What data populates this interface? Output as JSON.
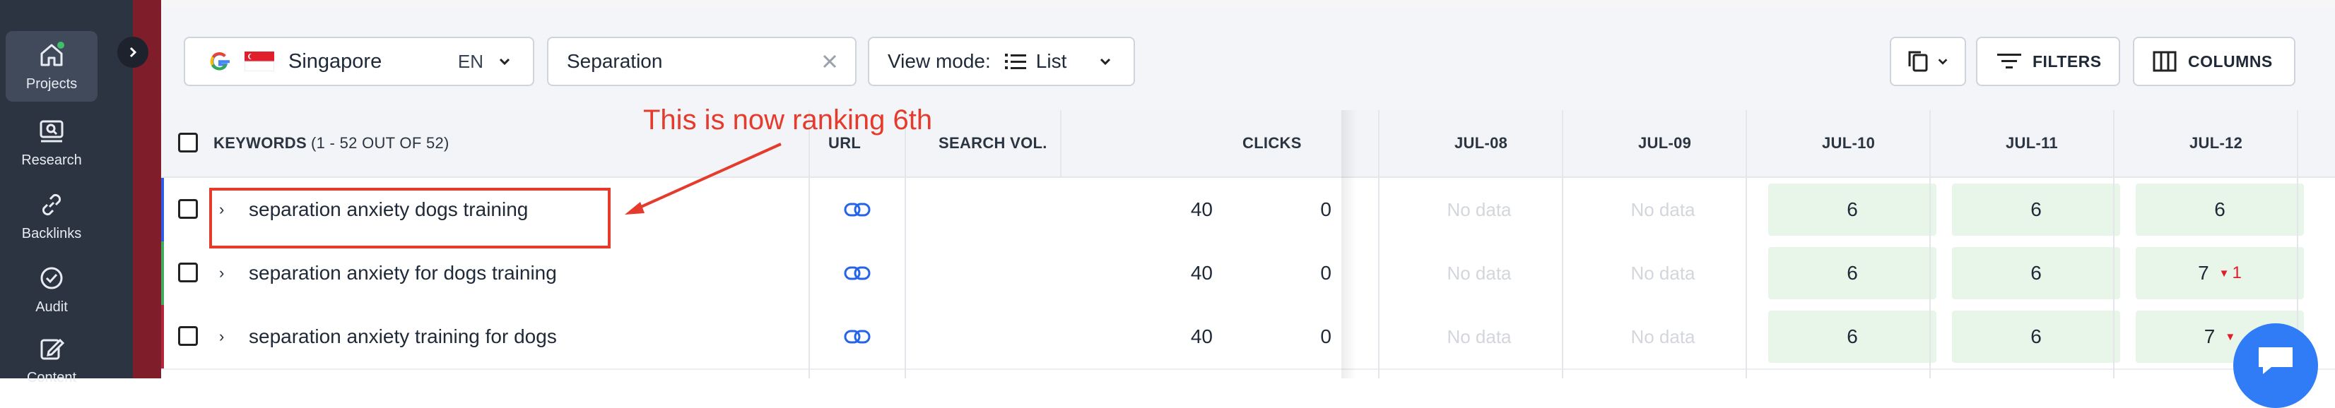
{
  "sidebar": {
    "items": [
      {
        "label": "Projects",
        "icon": "home-icon",
        "active": true
      },
      {
        "label": "Research",
        "icon": "research-icon"
      },
      {
        "label": "Backlinks",
        "icon": "link-icon"
      },
      {
        "label": "Audit",
        "icon": "check-circle-icon"
      },
      {
        "label": "Content",
        "icon": "edit-icon"
      }
    ]
  },
  "toolbar": {
    "location": "Singapore",
    "language": "EN",
    "search_value": "Separation",
    "view_mode_label": "View mode:",
    "view_mode_value": "List",
    "filters_label": "FILTERS",
    "columns_label": "COLUMNS"
  },
  "table": {
    "headers": {
      "keywords": "KEYWORDS",
      "keywords_count": "(1 - 52 OUT OF 52)",
      "url": "URL",
      "search_vol": "SEARCH VOL.",
      "clicks": "CLICKS"
    },
    "date_headers": [
      "JUL-08",
      "JUL-09",
      "JUL-10",
      "JUL-11",
      "JUL-12"
    ],
    "rows": [
      {
        "keyword": "separation anxiety dogs training",
        "search_vol": "40",
        "clicks": "0",
        "dates": [
          "No data",
          "No data",
          "6",
          "6",
          "6"
        ],
        "change": ""
      },
      {
        "keyword": "separation anxiety for dogs training",
        "search_vol": "40",
        "clicks": "0",
        "dates": [
          "No data",
          "No data",
          "6",
          "6",
          "7"
        ],
        "change": "1"
      },
      {
        "keyword": "separation anxiety training for dogs",
        "search_vol": "40",
        "clicks": "0",
        "dates": [
          "No data",
          "No data",
          "6",
          "6",
          "7"
        ],
        "change": ""
      }
    ]
  },
  "annotation": {
    "text": "This is now ranking 6th"
  },
  "colors": {
    "sidebar_bg": "#2c3341",
    "annotation_red": "#e53b2c",
    "link_blue": "#2563eb",
    "positive_bg": "#e8f6ea",
    "decline_red": "#e11d2a"
  }
}
